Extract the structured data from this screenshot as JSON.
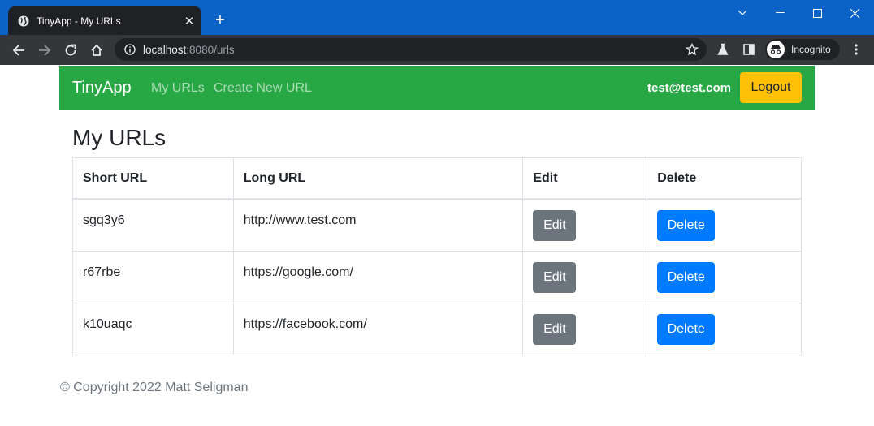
{
  "browser": {
    "tab_title": "TinyApp - My URLs",
    "url_host": "localhost",
    "url_rest": ":8080/urls",
    "profile_label": "Incognito"
  },
  "navbar": {
    "brand": "TinyApp",
    "links": [
      "My URLs",
      "Create New URL"
    ],
    "user_email": "test@test.com",
    "logout_label": "Logout"
  },
  "main": {
    "title": "My URLs",
    "table": {
      "headers": [
        "Short URL",
        "Long URL",
        "Edit",
        "Delete"
      ],
      "rows": [
        {
          "short": "sgq3y6",
          "long": "http://www.test.com",
          "edit": "Edit",
          "delete": "Delete"
        },
        {
          "short": "r67rbe",
          "long": "https://google.com/",
          "edit": "Edit",
          "delete": "Delete"
        },
        {
          "short": "k10uaqc",
          "long": "https://facebook.com/",
          "edit": "Edit",
          "delete": "Delete"
        }
      ]
    }
  },
  "footer": {
    "text": "© Copyright 2022 Matt Seligman"
  },
  "colors": {
    "navbar": "#28a745",
    "logout": "#ffc107",
    "edit_button": "#6c757d",
    "delete_button": "#007bff"
  },
  "icons": [
    "globe-icon",
    "close-icon",
    "plus-icon",
    "back-icon",
    "forward-icon",
    "reload-icon",
    "home-icon",
    "info-icon",
    "star-icon",
    "labs-icon",
    "sidepanel-icon",
    "incognito-icon",
    "menu-icon",
    "minimize-icon",
    "maximize-icon",
    "window-close-icon",
    "chevron-down-icon"
  ]
}
